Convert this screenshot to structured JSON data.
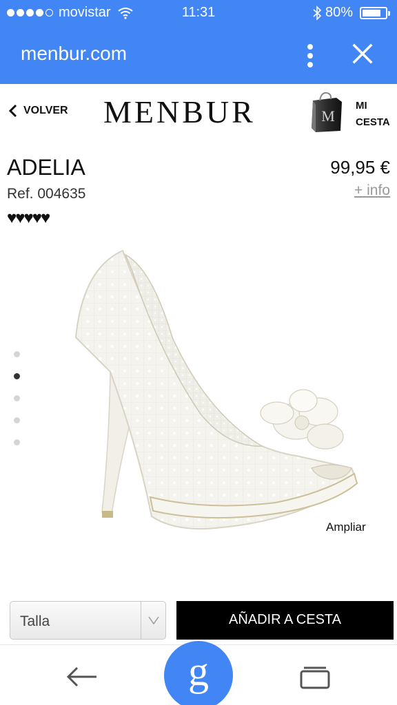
{
  "status_bar": {
    "carrier": "movistar",
    "time": "11:31",
    "battery": "80%",
    "battery_level": 0.8
  },
  "browser": {
    "url": "menbur.com",
    "icons": [
      "menu-dots-icon",
      "close-icon"
    ]
  },
  "header": {
    "back_label": "VOLVER",
    "logo": "MENBUR",
    "bag_logo_letter": "M",
    "cart_label_line1": "MI",
    "cart_label_line2": "CESTA"
  },
  "product": {
    "name": "ADELIA",
    "ref": "Ref. 004635",
    "rating_hearts": "♥♥♥♥♥",
    "rating": 5,
    "price": "99,95 €",
    "info_link": "+ info"
  },
  "gallery": {
    "image_count": 5,
    "active_index": 1,
    "zoom_label": "Ampliar"
  },
  "actions": {
    "size_label": "Talla",
    "add_to_cart": "AÑADIR A CESTA"
  },
  "bottom_bar": {
    "google_label": "g",
    "icons": [
      "back-arrow-icon",
      "google-icon",
      "tabs-icon"
    ]
  },
  "colors": {
    "browser_blue": "#4285f4",
    "button_black": "#000000",
    "link_gray": "#999999"
  }
}
